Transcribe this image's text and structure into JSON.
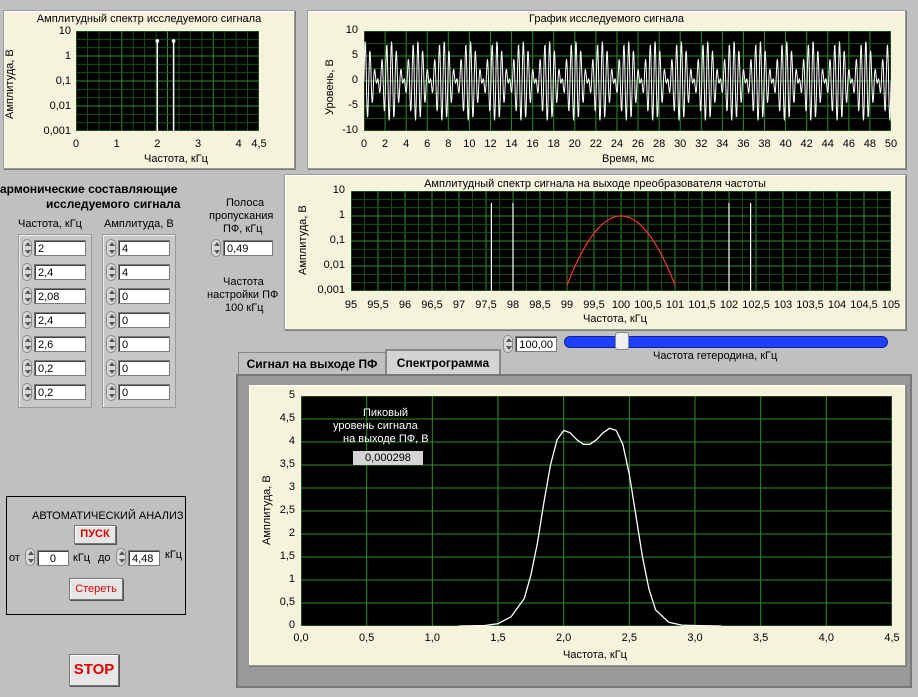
{
  "spectrum_panel": {
    "title": "Амплитудный спектр исследуемого сигнала",
    "xlabel": "Частота, кГц",
    "ylabel": "Амплитуда, В",
    "yticks": [
      "10",
      "1",
      "0,1",
      "0,01",
      "0,001"
    ],
    "xticks": [
      "0",
      "1",
      "2",
      "3",
      "4",
      "4,5"
    ]
  },
  "signal_panel": {
    "title": "График исследуемого сигнала",
    "xlabel": "Время, мс",
    "ylabel": "Уровень, В",
    "yticks": [
      "10",
      "5",
      "0",
      "-5",
      "-10"
    ],
    "xticks": [
      "0",
      "2",
      "4",
      "6",
      "8",
      "10",
      "12",
      "14",
      "16",
      "18",
      "20",
      "22",
      "24",
      "26",
      "28",
      "30",
      "32",
      "34",
      "36",
      "38",
      "40",
      "42",
      "44",
      "46",
      "48",
      "50"
    ]
  },
  "converter_panel": {
    "title": "Амплитудный спектр сигнала на выходе преобразователя частоты",
    "xlabel": "Частота, кГц",
    "ylabel": "Амплитуда, В",
    "yticks": [
      "10",
      "1",
      "0,1",
      "0,01",
      "0,001"
    ],
    "xticks": [
      "95",
      "95,5",
      "96",
      "96,5",
      "97",
      "97,5",
      "98",
      "98,5",
      "99",
      "99,5",
      "100",
      "100,5",
      "101",
      "101,5",
      "102",
      "102,5",
      "103",
      "103,5",
      "104",
      "104,5",
      "105"
    ]
  },
  "harmonics": {
    "heading_line1": "армонические составляющие",
    "heading_line2": "исследуемого сигнала",
    "freq_header": "Частота, кГц",
    "amp_header": "Амплитуда, В",
    "freqs": [
      "2",
      "2,4",
      "2,08",
      "2,4",
      "2,6",
      "0,2",
      "0,2"
    ],
    "amps": [
      "4",
      "4",
      "0",
      "0",
      "0",
      "0",
      "0"
    ]
  },
  "bandpass": {
    "label_line1": "Полоса",
    "label_line2": "пропускания",
    "label_line3": "ПФ, кГц",
    "value": "0,49",
    "tuning_line1": "Частота",
    "tuning_line2": "настройки ПФ",
    "tuning_line3": "100 кГц"
  },
  "heterodyne": {
    "value": "100,00",
    "label": "Частота гетеродина, кГц",
    "slider_fraction": 0.18
  },
  "tabs": {
    "tab1": "Сигнал на выходе ПФ",
    "tab2": "Спектрограмма"
  },
  "spectrogram": {
    "xlabel": "Частота, кГц",
    "ylabel": "Амплитуда, В",
    "yticks": [
      "5",
      "4,5",
      "4",
      "3,5",
      "3",
      "2,5",
      "2",
      "1,5",
      "1",
      "0,5",
      "0"
    ],
    "xticks": [
      "0,0",
      "0,5",
      "1,0",
      "1,5",
      "2,0",
      "2,5",
      "3,0",
      "3,5",
      "4,0",
      "4,5"
    ],
    "peak_line1": "Пиковый",
    "peak_line2": "уровень сигнала",
    "peak_line3": "на выходе ПФ, В",
    "peak_value": "0,000298"
  },
  "auto_analysis": {
    "title": "АВТОМАТИЧЕСКИЙ АНАЛИЗ",
    "start_button": "ПУСК",
    "from_label": "от",
    "from_value": "0",
    "unit1": "кГц",
    "to_label": "до",
    "to_value": "4,48",
    "unit2": "кГц",
    "clear_button": "Стереть"
  },
  "stop_button": "STOP",
  "chart_data": [
    {
      "type": "bar",
      "name": "input spectrum",
      "x": [
        2,
        2.4
      ],
      "values": [
        4,
        4
      ],
      "yscale": "log",
      "xlim": [
        0,
        4.5
      ],
      "ylim": [
        0.001,
        10
      ]
    },
    {
      "type": "line",
      "name": "input signal",
      "xlim": [
        0,
        50
      ],
      "ylim": [
        -10,
        10
      ],
      "amplitude_peak": 8,
      "beat_period_ms": 2.5
    },
    {
      "type": "line",
      "name": "converter output spectrum",
      "lines_x": [
        97.6,
        98,
        102,
        102.4
      ],
      "filter_center": 100,
      "filter_peak": 1,
      "filter_edges": [
        99,
        101
      ],
      "yscale": "log",
      "xlim": [
        95,
        105
      ],
      "ylim": [
        0.001,
        10
      ]
    },
    {
      "type": "line",
      "name": "spectrogram",
      "xlim": [
        0,
        4.5
      ],
      "ylim": [
        0,
        5
      ],
      "x": [
        1.2,
        1.4,
        1.5,
        1.6,
        1.7,
        1.75,
        1.8,
        1.85,
        1.9,
        1.95,
        2.0,
        2.05,
        2.1,
        2.15,
        2.2,
        2.25,
        2.3,
        2.35,
        2.4,
        2.45,
        2.5,
        2.55,
        2.6,
        2.65,
        2.7,
        2.8,
        2.9,
        3.0,
        3.2
      ],
      "y": [
        0,
        0.01,
        0.05,
        0.2,
        0.6,
        1.1,
        1.8,
        2.7,
        3.5,
        4.05,
        4.25,
        4.2,
        4.05,
        3.95,
        3.95,
        4.05,
        4.2,
        4.3,
        4.25,
        3.95,
        3.3,
        2.4,
        1.5,
        0.8,
        0.35,
        0.08,
        0.02,
        0.01,
        0
      ]
    }
  ]
}
